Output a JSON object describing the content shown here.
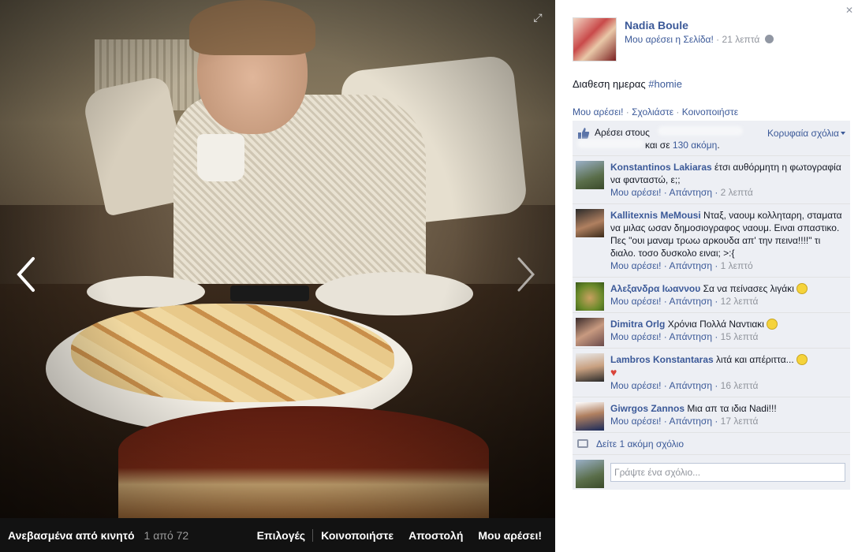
{
  "photo": {
    "uploaded_label": "Ανεβασμένα από κινητό",
    "counter": "1 από 72",
    "actions": [
      "Επιλογές",
      "Κοινοποιήστε",
      "Αποστολή",
      "Μου αρέσει!"
    ]
  },
  "post": {
    "page_name": "Nadia Boule",
    "like_page": "Μου αρέσει η Σελίδα!",
    "time": "21 λεπτά",
    "caption_text": "Διαθεση ημερας ",
    "caption_tag": "#homie",
    "actions": [
      "Μου αρέσει!",
      "Σχολιάστε",
      "Κοινοποιήστε"
    ]
  },
  "likes": {
    "prefix": "Αρέσει στους",
    "and_more_prefix": "και σε ",
    "and_more_count": "130 ακόμη",
    "and_more_suffix": ".",
    "top_comments": "Κορυφαία σχόλια"
  },
  "comment_labels": {
    "like": "Μου αρέσει!",
    "reply": "Απάντηση"
  },
  "comments": [
    {
      "author": "Konstantinos Lakiaras",
      "text": "έτσι αυθόρμητη η φωτογραφία να φανταστώ, ε;;",
      "time": "2 λεπτά"
    },
    {
      "author": "Kallitexnis MeMousi",
      "text": "Νταξ, ναουμ κολληταρη, σταματα να μιλας ωσαν δημοσιογραφος ναουμ. Ειναι σπαστικο. Πες \"ουι μαναμ τρωω αρκουδα απ' την πεινα!!!!\" τι διαλο. τοσο δυσκολο ειναι; >:{",
      "time": "1 λεπτό"
    },
    {
      "author": "Αλεξανδρα Ιωαννου",
      "text": "Σα να πείνασες λιγάκι",
      "time": "12 λεπτά"
    },
    {
      "author": "Dimitra Orlg",
      "text": "Χρόνια Πολλά Ναντιακι",
      "time": "15 λεπτά"
    },
    {
      "author": "Lambros Konstantaras",
      "text": "λιτά και απέριττα...",
      "time": "16 λεπτά"
    },
    {
      "author": "Giwrgos Zannos",
      "text": "Μια απ τα ιδια Nadi!!!",
      "time": "17 λεπτά"
    }
  ],
  "more_comments": "Δείτε 1 ακόμη σχόλιο",
  "compose_placeholder": "Γράψτε ένα σχόλιο...",
  "colors": {
    "link": "#3b5998",
    "ufi_bg": "#edeff4",
    "photo_bar": "#141414"
  }
}
